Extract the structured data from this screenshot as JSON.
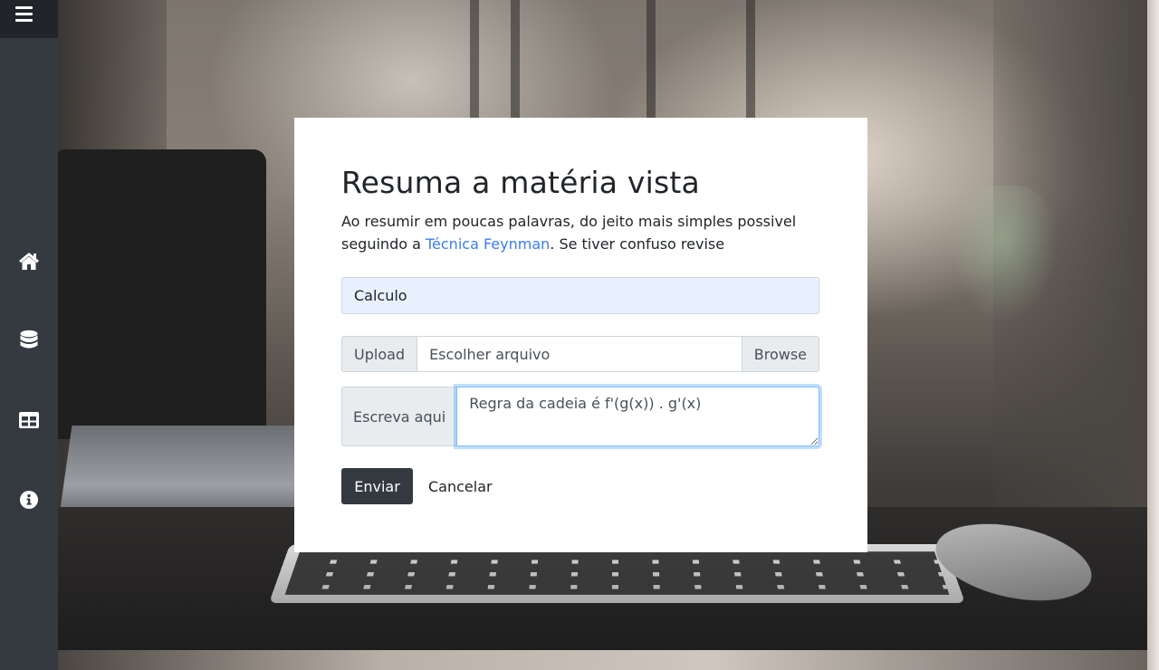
{
  "sidebar": {
    "toggle_icon": "hamburger-menu-icon",
    "items": [
      {
        "id": "home",
        "icon": "home-icon"
      },
      {
        "id": "database",
        "icon": "database-icon"
      },
      {
        "id": "table",
        "icon": "table-icon"
      },
      {
        "id": "info",
        "icon": "info-circle-icon"
      }
    ]
  },
  "form": {
    "title": "Resuma a matéria vista",
    "description_before": "Ao resumir em poucas palavras, do jeito mais simples possivel seguindo a ",
    "description_link": "Técnica Feynman",
    "description_after": ". Se tiver confuso revise",
    "subject_value": "Calculo",
    "upload_prefix": "Upload",
    "upload_placeholder": "Escolher arquivo",
    "upload_browse": "Browse",
    "write_prefix": "Escreva aqui",
    "write_value": "Regra da cadeia é f'(g(x)) . g'(x)",
    "submit_label": "Enviar",
    "cancel_label": "Cancelar"
  },
  "colors": {
    "sidebar": "#343a40",
    "toggle": "#212529",
    "link": "#3b7df0",
    "button": "#343a40"
  }
}
